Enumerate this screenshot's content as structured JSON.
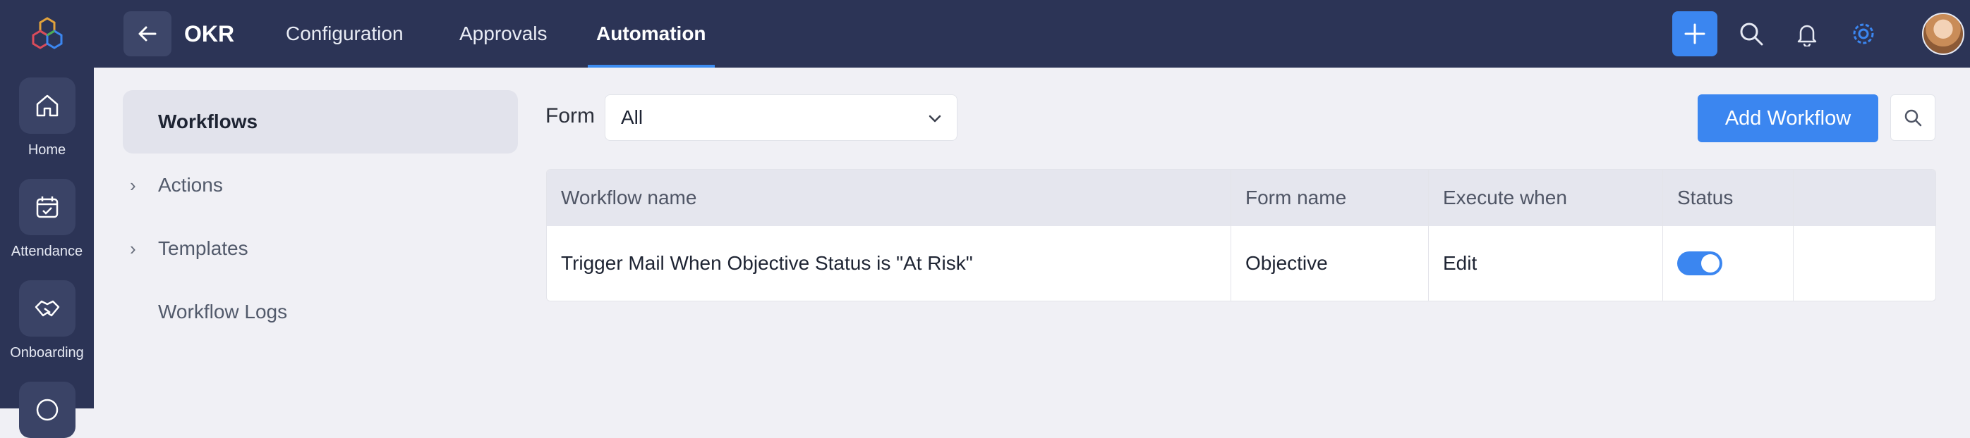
{
  "rail": {
    "items": [
      {
        "label": "Home",
        "icon": "home-icon"
      },
      {
        "label": "Attendance",
        "icon": "calendar-check-icon"
      },
      {
        "label": "Onboarding",
        "icon": "handshake-icon"
      }
    ]
  },
  "header": {
    "title": "OKR",
    "tabs": [
      {
        "label": "Configuration"
      },
      {
        "label": "Approvals"
      },
      {
        "label": "Automation",
        "active": true
      }
    ],
    "accent": "#3b86f0"
  },
  "sidebar": {
    "items": [
      {
        "label": "Workflows",
        "active": true
      },
      {
        "label": "Actions",
        "expandable": true
      },
      {
        "label": "Templates",
        "expandable": true
      },
      {
        "label": "Workflow Logs"
      }
    ]
  },
  "filter": {
    "form_label": "Form",
    "selected": "All"
  },
  "toolbar": {
    "add_label": "Add Workflow"
  },
  "table": {
    "columns": [
      "Workflow name",
      "Form name",
      "Execute when",
      "Status",
      ""
    ],
    "rows": [
      {
        "workflow_name": "Trigger Mail When Objective Status is \"At Risk\"",
        "form_name": "Objective",
        "execute_when": "Edit",
        "status_enabled": true
      }
    ]
  }
}
